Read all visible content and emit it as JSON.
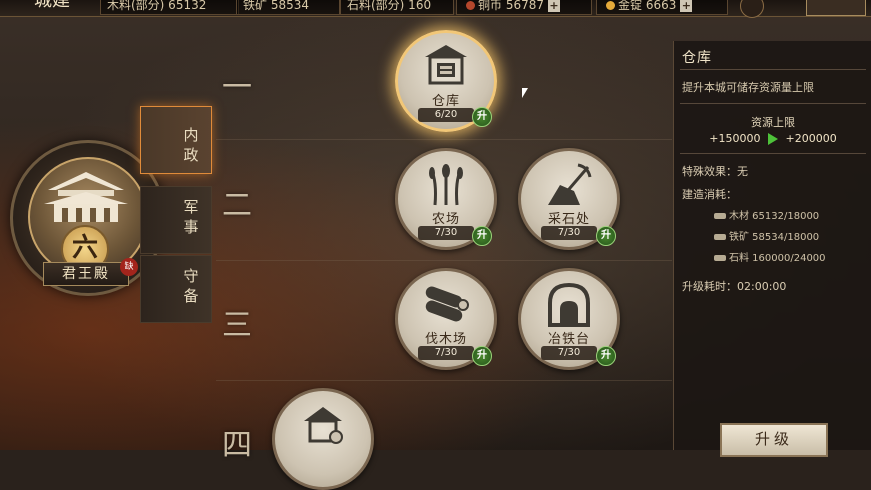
{
  "topbar": {
    "title": "城建",
    "res_wood": "木料(部分) 65132",
    "res_iron": "铁矿 58534",
    "res_stone": "石料(部分) 160",
    "res_copper": "铜币 56787",
    "res_gold": "金锭 6663"
  },
  "palace": {
    "grade": "六",
    "name": "君王殿",
    "badge": "缺"
  },
  "tabs": [
    {
      "label": "内政"
    },
    {
      "label": "军事"
    },
    {
      "label": "守备"
    }
  ],
  "rows": [
    "一",
    "二",
    "三",
    "四"
  ],
  "buildings": [
    {
      "name": "仓库",
      "count": "6/20",
      "up": "升"
    },
    {
      "name": "农场",
      "count": "7/30",
      "up": "升"
    },
    {
      "name": "采石处",
      "count": "7/30",
      "up": "升"
    },
    {
      "name": "伐木场",
      "count": "7/30",
      "up": "升"
    },
    {
      "name": "冶铁台",
      "count": "7/30",
      "up": "升"
    }
  ],
  "panel": {
    "title": "仓库",
    "description": "提升本城可储存资源量上限",
    "capacity_title": "资源上限",
    "capacity_from": "+150000",
    "capacity_to": "+200000",
    "effect": "特殊效果：无",
    "cost_title": "建造消耗：",
    "costs": [
      {
        "label": "木材 65132/18000"
      },
      {
        "label": "铁矿 58534/18000"
      },
      {
        "label": "石料 160000/24000"
      }
    ],
    "time": "升级耗时：02:00:00"
  },
  "upgrade_button": "升级",
  "colors": {
    "accent_orange": "#e08b3a",
    "upgrade_green": "#3f7d28",
    "arrow_green": "#4ec23a",
    "glow": "#f2c777"
  }
}
